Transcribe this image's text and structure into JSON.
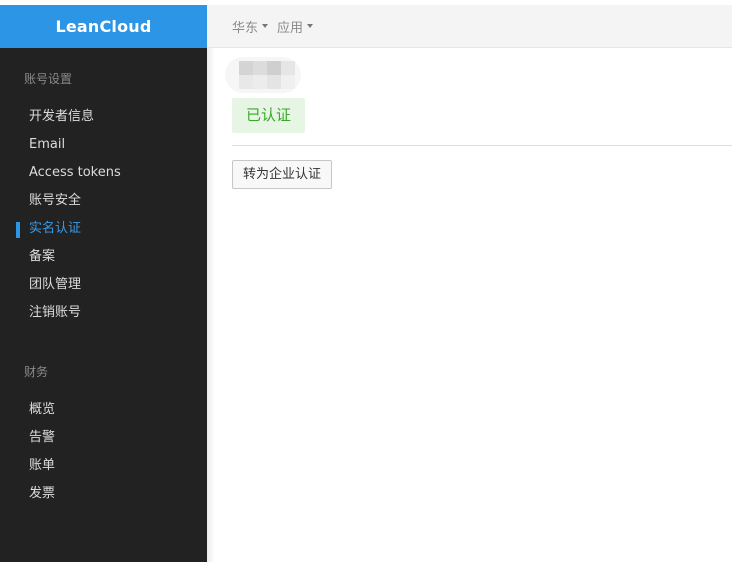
{
  "brand": {
    "name": "LeanCloud",
    "color": "#2c95e6"
  },
  "sidebar": {
    "sections": [
      {
        "title": "账号设置",
        "items": [
          {
            "label": "开发者信息",
            "active": false
          },
          {
            "label": "Email",
            "active": false
          },
          {
            "label": "Access tokens",
            "active": false
          },
          {
            "label": "账号安全",
            "active": false
          },
          {
            "label": "实名认证",
            "active": true
          },
          {
            "label": "备案",
            "active": false
          },
          {
            "label": "团队管理",
            "active": false
          },
          {
            "label": "注销账号",
            "active": false
          }
        ]
      },
      {
        "title": "财务",
        "items": [
          {
            "label": "概览",
            "active": false
          },
          {
            "label": "告警",
            "active": false
          },
          {
            "label": "账单",
            "active": false
          },
          {
            "label": "发票",
            "active": false
          }
        ]
      }
    ]
  },
  "topbar": {
    "region_dropdown": {
      "label": "华东",
      "icon": "caret-down-icon"
    },
    "app_dropdown": {
      "label": "应用",
      "icon": "caret-down-icon"
    }
  },
  "main": {
    "user_name_blurred": true,
    "status_badge": {
      "label": "已认证",
      "color": "#3aa829",
      "background": "#e7f5e4"
    },
    "convert_button": {
      "label": "转为企业认证"
    }
  }
}
